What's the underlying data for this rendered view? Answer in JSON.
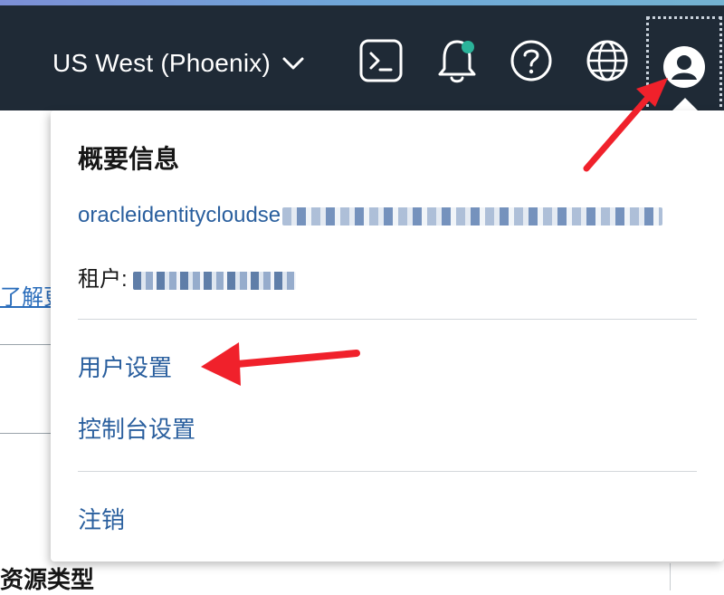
{
  "header": {
    "region_label": "US West (Phoenix)",
    "icons": [
      "cloud-shell-icon",
      "bell-icon",
      "help-icon",
      "globe-icon",
      "user-avatar-icon"
    ],
    "notification_dot_color": "#2bb39a",
    "background_color": "#1f2a36"
  },
  "page": {
    "link_text": "了解更",
    "section_heading": "资源类型"
  },
  "dropdown": {
    "title": "概要信息",
    "email_prefix": "oracleidentitycloudse",
    "tenant_label": "租户:",
    "menu": {
      "user_settings": "用户设置",
      "console_settings": "控制台设置",
      "sign_out": "注销"
    }
  },
  "colors": {
    "link": "#2a5f9e",
    "annotation_arrow": "#f0212b"
  }
}
